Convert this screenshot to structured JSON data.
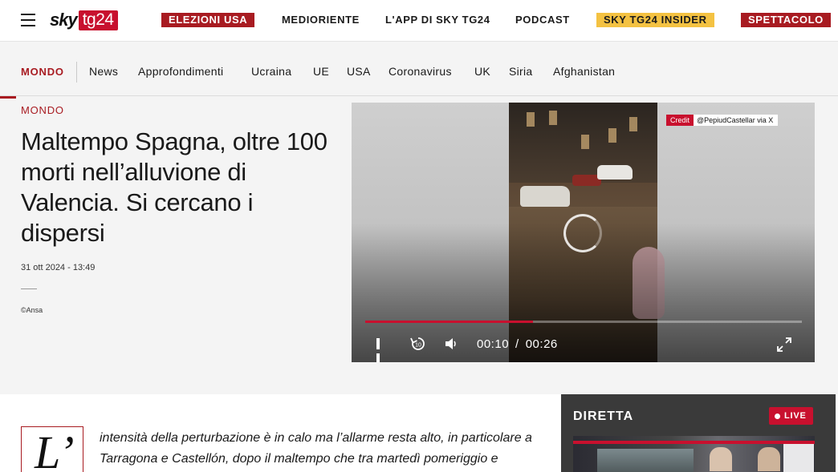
{
  "header": {
    "menu_icon": "hamburger-menu-icon",
    "logo": {
      "sky": "sky",
      "tg24": "tg24"
    },
    "nav": [
      {
        "label": "ELEZIONI USA",
        "style": "boxed-red"
      },
      {
        "label": "MEDIORIENTE",
        "style": "plain"
      },
      {
        "label": "L'APP DI SKY TG24",
        "style": "plain"
      },
      {
        "label": "PODCAST",
        "style": "plain"
      },
      {
        "label": "SKY TG24 INSIDER",
        "style": "boxed-yellow"
      },
      {
        "label": "SPETTACOLO",
        "style": "boxed-red"
      }
    ]
  },
  "section_nav": {
    "active": "MONDO",
    "items": [
      "News",
      "Approfondimenti",
      "Ucraina",
      "UE",
      "USA",
      "Coronavirus",
      "UK",
      "Siria",
      "Afghanistan"
    ]
  },
  "article": {
    "kicker": "MONDO",
    "headline": "Maltempo Spagna, oltre 100 morti nell’alluvione di Valencia. Si cercano i dispersi",
    "date": "31 ott 2024 - 13:49",
    "photo_credit": "©Ansa",
    "dropcap": "L’",
    "lead": "intensità della perturbazione è in calo ma l’allarme resta alto, in particolare a Tarragona e Castellón, dopo il maltempo che tra martedì pomeriggio e"
  },
  "video": {
    "credit_tag": "Credit",
    "credit_source": "@PepiudCastellar via X",
    "current_time": "00:10",
    "separator": "/",
    "duration": "00:26",
    "progress_fraction": 0.385,
    "icons": [
      "pause-icon",
      "replay-10-icon",
      "volume-icon",
      "fullscreen-icon",
      "loading-spinner-icon"
    ]
  },
  "live": {
    "title": "DIRETTA",
    "badge": "LIVE"
  },
  "colors": {
    "brand_red": "#a81b21",
    "live_red": "#c8102e",
    "insider_yellow": "#f4c242",
    "subnav_bg": "#f4f4f4",
    "live_box_bg": "#3a3a3a"
  }
}
